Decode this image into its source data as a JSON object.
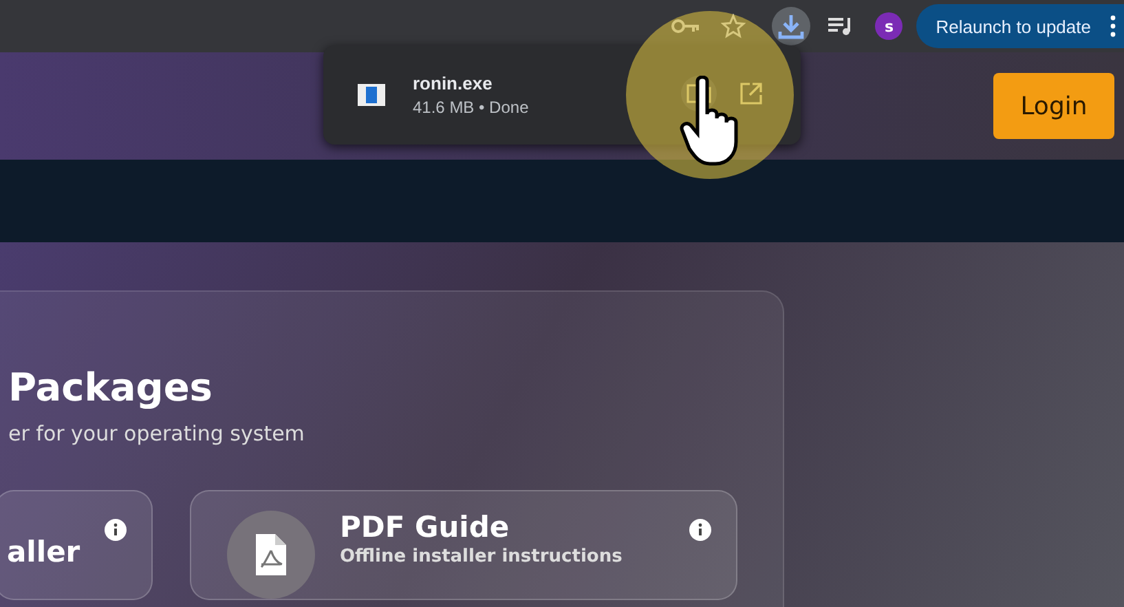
{
  "toolbar": {
    "downloads_active": true,
    "profile_initial": "s",
    "relaunch_button": "Relaunch to update"
  },
  "download_popup": {
    "items": [
      {
        "filename": "ronin.exe",
        "status": "41.6 MB • Done"
      }
    ]
  },
  "header": {
    "login_button": "Login"
  },
  "section": {
    "title": "Packages",
    "subtitle": "er for your operating system",
    "cards": [
      {
        "kind": "partial",
        "title": "aller"
      },
      {
        "kind": "icon",
        "title": "PDF Guide",
        "description": "Offline installer instructions"
      }
    ]
  }
}
